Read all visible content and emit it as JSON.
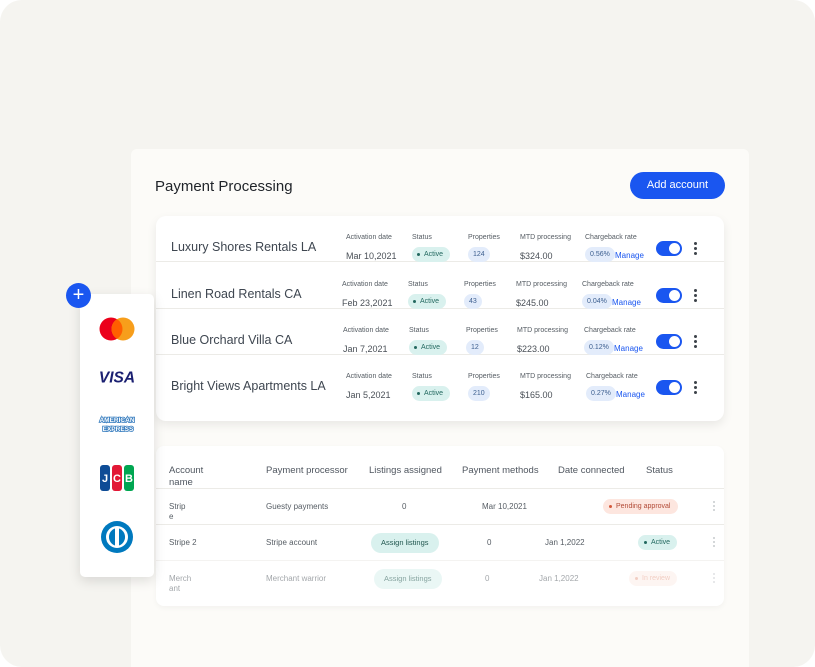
{
  "page": {
    "title": "Payment Processing",
    "add_button": "Add account"
  },
  "accounts": {
    "labels": {
      "activation": "Activation date",
      "status": "Status",
      "properties": "Properties",
      "mtd": "MTD processing",
      "chargeback": "Chargeback rate",
      "manage": "Manage"
    },
    "rows": [
      {
        "name": "Luxury Shores Rentals LA",
        "date": "Mar 10,2021",
        "status": "Active",
        "properties": "124",
        "mtd": "$324.00",
        "rate": "0.56%",
        "enabled": true
      },
      {
        "name": "Linen Road Rentals CA",
        "date": "Feb 23,2021",
        "status": "Active",
        "properties": "43",
        "mtd": "$245.00",
        "rate": "0.04%",
        "enabled": true
      },
      {
        "name": "Blue Orchard Villa CA",
        "date": "Jan 7,2021",
        "status": "Active",
        "properties": "12",
        "mtd": "$223.00",
        "rate": "0.12%",
        "enabled": true
      },
      {
        "name": "Bright Views Apartments LA",
        "date": "Jan 5,2021",
        "status": "Active",
        "properties": "210",
        "mtd": "$165.00",
        "rate": "0.27%",
        "enabled": true
      }
    ]
  },
  "connected": {
    "headers": {
      "account_name": "Account name",
      "processor": "Payment processor",
      "listings": "Listings assigned",
      "methods": "Payment methods",
      "date": "Date connected",
      "status": "Status"
    },
    "rows": [
      {
        "account": "Stripe",
        "processor": "Guesty payments",
        "listings": "0",
        "methods": "",
        "date": "Mar 10,2021",
        "status": "Pending approval"
      },
      {
        "account": "Stripe 2",
        "processor": "Stripe account",
        "listings": "Assign listings",
        "methods": "0",
        "date": "Jan 1,2022",
        "status": "Active"
      },
      {
        "account": "Merchant",
        "processor": "Merchant warrior",
        "listings": "Assign listings",
        "methods": "0",
        "date": "Jan 1,2022",
        "status": "In review"
      }
    ]
  },
  "card_brands": [
    {
      "name": "Mastercard",
      "icon": "mastercard-logo"
    },
    {
      "name": "VISA",
      "icon": "visa-logo"
    },
    {
      "name": "AMERICAN EXPRESS",
      "icon": "amex-logo"
    },
    {
      "name": "JCB",
      "icon": "jcb-logo"
    },
    {
      "name": "Diners Club",
      "icon": "diners-logo"
    }
  ],
  "colors": {
    "accent": "#1a56f0",
    "active_bg": "#d9f1ee",
    "pending_bg": "#fde6df"
  }
}
